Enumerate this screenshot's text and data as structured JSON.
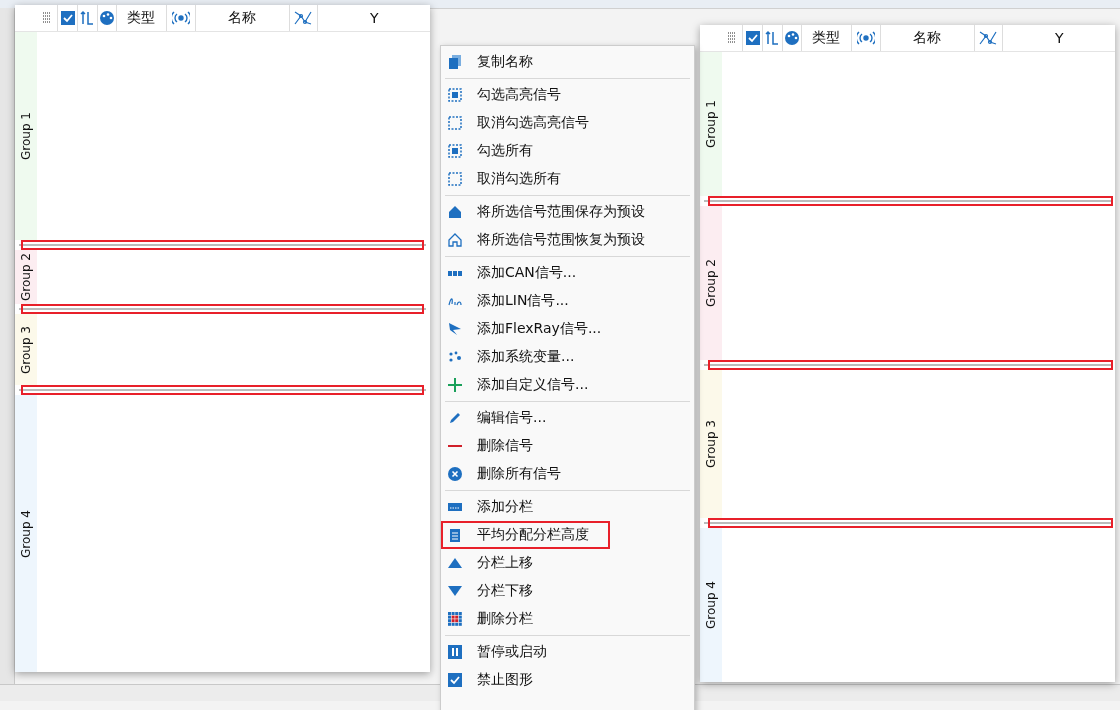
{
  "panels": [
    {
      "columns": [
        {
          "label": "类型"
        },
        {
          "label": "名称"
        },
        {
          "label": "Y"
        }
      ],
      "groups": [
        {
          "label": "Group 1",
          "color": "#effaef"
        },
        {
          "label": "Group 2",
          "color": "#fcedf1"
        },
        {
          "label": "Group 3",
          "color": "#fcf9ea"
        },
        {
          "label": "Group 4",
          "color": "#eef6fd"
        }
      ]
    },
    {
      "columns": [
        {
          "label": "类型"
        },
        {
          "label": "名称"
        },
        {
          "label": "Y"
        }
      ],
      "groups": [
        {
          "label": "Group 1",
          "color": "#effaef"
        },
        {
          "label": "Group 2",
          "color": "#fcedf1"
        },
        {
          "label": "Group 3",
          "color": "#fcf9ea"
        },
        {
          "label": "Group 4",
          "color": "#eef6fd"
        }
      ]
    }
  ],
  "context_menu": {
    "sections": [
      [
        {
          "label": "复制名称",
          "marked": false
        }
      ],
      [
        {
          "label": "勾选高亮信号",
          "marked": false
        },
        {
          "label": "取消勾选高亮信号",
          "marked": false
        },
        {
          "label": "勾选所有",
          "marked": false
        },
        {
          "label": "取消勾选所有",
          "marked": false
        }
      ],
      [
        {
          "label": "将所选信号范围保存为预设",
          "marked": false
        },
        {
          "label": "将所选信号范围恢复为预设",
          "marked": false
        }
      ],
      [
        {
          "label": "添加CAN信号...",
          "marked": false
        },
        {
          "label": "添加LIN信号...",
          "marked": false
        },
        {
          "label": "添加FlexRay信号...",
          "marked": false
        },
        {
          "label": "添加系统变量...",
          "marked": false
        },
        {
          "label": "添加自定义信号...",
          "marked": false
        }
      ],
      [
        {
          "label": "编辑信号...",
          "marked": false
        },
        {
          "label": "删除信号",
          "marked": false
        },
        {
          "label": "删除所有信号",
          "marked": false
        }
      ],
      [
        {
          "label": "添加分栏",
          "marked": false
        },
        {
          "label": "平均分配分栏高度",
          "marked": true
        },
        {
          "label": "分栏上移",
          "marked": false
        },
        {
          "label": "分栏下移",
          "marked": false
        },
        {
          "label": "删除分栏",
          "marked": false
        }
      ],
      [
        {
          "label": "暂停或启动",
          "marked": false
        },
        {
          "label": "禁止图形",
          "marked": false
        }
      ]
    ]
  }
}
